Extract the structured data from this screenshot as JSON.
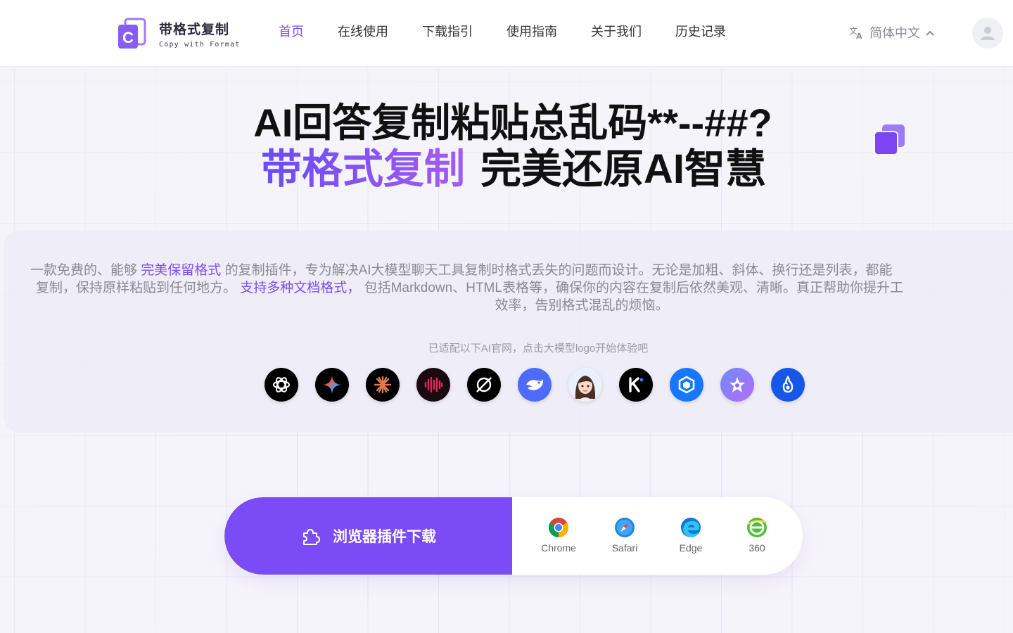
{
  "brand": {
    "name_cn": "带格式复制",
    "name_en": "Copy with Format",
    "logo_icon": "c-copy-logo-icon",
    "accent": "#7b4cf5"
  },
  "nav": [
    {
      "label": "首页",
      "active": true
    },
    {
      "label": "在线使用",
      "active": false
    },
    {
      "label": "下载指引",
      "active": false
    },
    {
      "label": "使用指南",
      "active": false
    },
    {
      "label": "关于我们",
      "active": false
    },
    {
      "label": "历史记录",
      "active": false
    }
  ],
  "language": {
    "label": "简体中文",
    "icon": "translate-icon"
  },
  "user": {
    "icon": "user-avatar-icon"
  },
  "hero": {
    "title": "AI回答复制粘贴总乱码**--##?",
    "subtitle_highlight": "带格式复制",
    "subtitle_rest": "完美还原AI智慧"
  },
  "description": {
    "p1": "一款免费的、能够 ",
    "hl1": "完美保留格式",
    "p2": " 的复制插件，专为解决AI大模型聊天工具复制时格式丢失的问题而设计。无论是加粗、斜体、换行还是列表，都能",
    "p3": "复制，保持原样粘贴到任何地方。 ",
    "hl2": "支持多种文档格式，",
    "p4": " 包括Markdown、HTML表格等，确保你的内容在复制后依然美观、清晰。真正帮助你提升工",
    "p5": "效率，告别格式混乱的烦恼。"
  },
  "ai_hint": "已适配以下AI官网，点击大模型logo开始体验吧",
  "ai_models": [
    {
      "icon": "chatgpt-icon"
    },
    {
      "icon": "gemini-icon"
    },
    {
      "icon": "claude-icon"
    },
    {
      "icon": "voice-wave-icon"
    },
    {
      "icon": "grok-icon"
    },
    {
      "icon": "deepseek-icon"
    },
    {
      "icon": "avatar-girl-icon"
    },
    {
      "icon": "kimi-icon"
    },
    {
      "icon": "hexagon-ai-icon"
    },
    {
      "icon": "star-ai-icon"
    },
    {
      "icon": "flame-ai-icon"
    }
  ],
  "download": {
    "button_label": "浏览器插件下载",
    "button_icon": "puzzle-icon",
    "browsers": [
      {
        "label": "Chrome",
        "icon": "chrome-icon"
      },
      {
        "label": "Safari",
        "icon": "safari-icon"
      },
      {
        "label": "Edge",
        "icon": "edge-icon"
      },
      {
        "label": "360",
        "icon": "360-browser-icon"
      }
    ]
  }
}
